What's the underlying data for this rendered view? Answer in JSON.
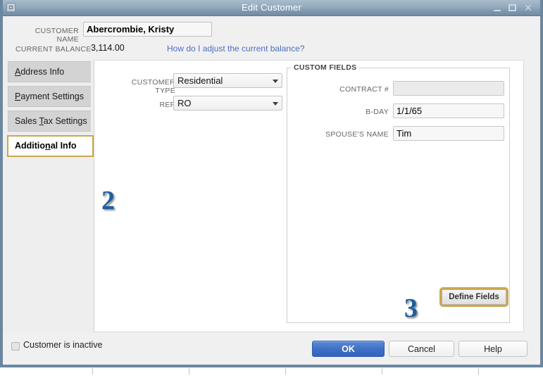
{
  "window": {
    "title": "Edit Customer",
    "sysmenu_icon": "system-menu-icon",
    "controls": {
      "minimize": "minimize-icon",
      "maximize": "maximize-icon",
      "close": "✕"
    }
  },
  "header": {
    "customer_name_label": "Customer Name",
    "customer_name_value": "Abercrombie, Kristy",
    "customer_name_placeholder": "",
    "current_balance_label": "Current Balance",
    "current_balance_value": "3,114.00",
    "adjust_balance_link": "How do I adjust the current balance?"
  },
  "sidebar": {
    "tabs": [
      {
        "label": "Address Info",
        "accel_before": "A",
        "accel": "d",
        "accel_after": "dress Info",
        "selected": false
      },
      {
        "label": "Payment Settings",
        "accel": "P",
        "accel_after": "ayment Settings",
        "selected": false
      },
      {
        "label": "Sales Tax Settings",
        "accel_before": "Sales ",
        "accel": "T",
        "accel_after": "ax Settings",
        "selected": false
      },
      {
        "label": "Additional Info",
        "accel_before": "Additio",
        "accel": "n",
        "accel_after": "al Info",
        "selected": true
      }
    ]
  },
  "main": {
    "customer_type_label": "Customer Type",
    "customer_type_value": "Residential",
    "rep_label": "Rep",
    "rep_value": "RO",
    "dropdown_icon": "chevron-down-icon",
    "custom_fields": {
      "legend": "Custom Fields",
      "rows": [
        {
          "label": "Contract #",
          "value": "",
          "readonly": true
        },
        {
          "label": "B-Day",
          "value": "1/1/65",
          "readonly": false
        },
        {
          "label": "Spouse's Name",
          "value": "Tim",
          "readonly": false
        }
      ],
      "define_fields_label": "Define Fields"
    }
  },
  "annotations": [
    {
      "id": "step-2",
      "text": "2"
    },
    {
      "id": "step-3",
      "text": "3"
    }
  ],
  "footer": {
    "inactive_label": "Customer is inactive",
    "inactive_checked": false,
    "ok_label": "OK",
    "cancel_label": "Cancel",
    "help_label": "Help"
  },
  "colors": {
    "titlebar_top": "#a9bccb",
    "titlebar_bottom": "#6f8aa2",
    "window_border": "#6b87a0",
    "highlight_gold": "#c9a84c",
    "link_blue": "#4a6fc4",
    "primary_button": "#3f6ec4",
    "annotation_blue": "#1f5e9e",
    "sidebar_bg": "#eeeeee",
    "tab_bg": "#d3d3d3"
  }
}
